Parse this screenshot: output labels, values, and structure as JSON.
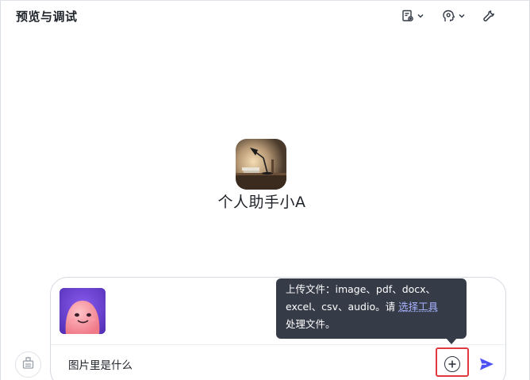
{
  "header": {
    "title": "预览与调试",
    "actions": [
      {
        "icon": "document-settings-icon",
        "has_dropdown": true
      },
      {
        "icon": "head-gear-icon",
        "has_dropdown": true
      },
      {
        "icon": "wrench-icon",
        "has_dropdown": false
      }
    ]
  },
  "bot": {
    "name": "个人助手小A",
    "avatar_icon": "desk-lamp-avatar"
  },
  "composer": {
    "attachment_icon": "pink-character-thumbnail",
    "input_value": "图片里是什么",
    "upload_icon": "plus-circle-icon",
    "send_icon": "send-icon",
    "side_icon": "bot-toolbox-icon"
  },
  "tooltip": {
    "line1": "上传文件：image、pdf、docx、",
    "line2_prefix": "excel、csv、audio。请 ",
    "link": "选择工具",
    "line3": "处理文件。"
  },
  "colors": {
    "accent": "#4e52f5",
    "highlight": "#e0393e",
    "tooltip_bg": "#363b48",
    "link": "#a8b4ff"
  }
}
